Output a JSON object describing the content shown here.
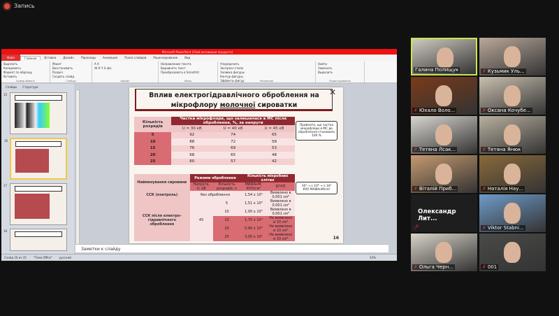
{
  "recording": {
    "label": "Запись",
    "color": "#e5483f"
  },
  "ppt": {
    "title": "Microsoft PowerPoint (Сбой активации продукта)",
    "tabs": [
      "Файл",
      "Главная",
      "Вставка",
      "Дизайн",
      "Переходы",
      "Анимация",
      "Показ слайдов",
      "Рецензирование",
      "Вид"
    ],
    "groups": [
      {
        "label": "Буфер обмена",
        "items": [
          "Вырезать",
          "Копировать",
          "Формат по образцу",
          "Вставить"
        ]
      },
      {
        "label": "Слайды",
        "items": [
          "Макет",
          "Восстановить",
          "Раздел",
          "Создать слайд"
        ]
      },
      {
        "label": "Шрифт",
        "items": [
          "A A",
          "Ж К Ч S abc"
        ]
      },
      {
        "label": "Абзац",
        "items": [
          "Направление текста",
          "Выровнять текст",
          "Преобразовать в SmartArt"
        ]
      },
      {
        "label": "Рисование",
        "items": [
          "Упорядочить",
          "Экспресс-стили",
          "Заливка фигуры",
          "Контур фигуры",
          "Эффекты фигур"
        ]
      },
      {
        "label": "Редактирование",
        "items": [
          "Найти",
          "Заменить",
          "Выделить"
        ]
      }
    ],
    "side_tabs": [
      "Слайды",
      "Структура"
    ],
    "thumbs": [
      "15",
      "16",
      "17",
      "18"
    ],
    "notes_placeholder": "Заметки к слайду",
    "status": {
      "slide": "Слайд 16 из 35",
      "theme": "\"Тема Office\"",
      "lang": "русский",
      "zoom": "43%"
    }
  },
  "slide": {
    "title_1": "Вплив електрогідравлічного оброблення на",
    "title_2a": "мікрофлору ",
    "title_2b": "молочної",
    "title_2c": " сироватки",
    "t1": {
      "h_rows": "Кількість розрядів",
      "h_main": "Частка мікрофлори, що залишилася в МС після оброблення, %, за напруги",
      "cols": [
        "U = 30 кВ",
        "U = 40 кВ",
        "U = 45 кВ"
      ],
      "rows": [
        [
          "5",
          "92",
          "74",
          "65"
        ],
        [
          "10",
          "88",
          "72",
          "58"
        ],
        [
          "15",
          "76",
          "69",
          "53"
        ],
        [
          "20",
          "68",
          "65",
          "48"
        ],
        [
          "25",
          "60",
          "57",
          "42"
        ]
      ]
    },
    "note1": "Прийнято, що частка мікрофлори в МС до оброблення становила 100 %",
    "t2": {
      "h_name": "Найменування сировини",
      "h_mode": "Режими оброблення",
      "h_count": "Кількість мікробних клітин",
      "h_volt": "Напруга, U, кВ",
      "h_disch": "Кількість розрядів, n",
      "h_mafanm": "МАФАнМ, КУО/см³",
      "h_bgkp": "БГКП",
      "ctrl_name": "ССК (контроль)",
      "ctrl_mode": "без оброблення",
      "ctrl_val": "1,54 x 10⁵",
      "ctrl_bgkp": "Виявлено в 0,001 см³",
      "treat_name": "ССК після електро-гідравлічного оброблення",
      "treat_volt": "45",
      "rows": [
        [
          "5",
          "1,51 x 10⁵",
          "Виявлено в 0,001 см³"
        ],
        [
          "10",
          "1,00 x 10⁵",
          "Виявлено в 0,001 см³"
        ],
        [
          "15",
          "1,70 x 10⁴",
          "Не виявлено в 10 см³"
        ],
        [
          "20",
          "0,90 x 10³",
          "Не виявлено в 10 см³"
        ],
        [
          "25",
          "3,00 x 10²",
          "Не виявлено в 10 см³"
        ]
      ]
    },
    "note2": "10⁵ → n 10⁴ → n 10³ КУО МАФАнМ/см³",
    "page": "16"
  },
  "participants": [
    {
      "name": "Галина Полищук",
      "active": true,
      "bg": "#cfc9c0"
    },
    {
      "name": "Кузьмик Уль...",
      "bg": "#b9a89a"
    },
    {
      "name": "Юхало Воло...",
      "bg": "#7a3a1a"
    },
    {
      "name": "Оксана Кочубе...",
      "bg": "#c8bfae"
    },
    {
      "name": "Тетяна Лсак...",
      "bg": "#d8d6d0"
    },
    {
      "name": "Тетяна Янюк",
      "bg": "#b8b0a0"
    },
    {
      "name": "Віталій Приб...",
      "bg": "#c59a70"
    },
    {
      "name": "Наталія Нау...",
      "bg": "#8a6a3a"
    },
    {
      "name": "Олександр Лит...",
      "bg": "#1e1e1e",
      "nocam": true
    },
    {
      "name": "Viktor Stabni...",
      "bg": "#6f9bc9"
    },
    {
      "name": "Ольга Черн...",
      "bg": "#d9d3c8"
    },
    {
      "name": "001",
      "bg": "#4a4a48"
    }
  ]
}
